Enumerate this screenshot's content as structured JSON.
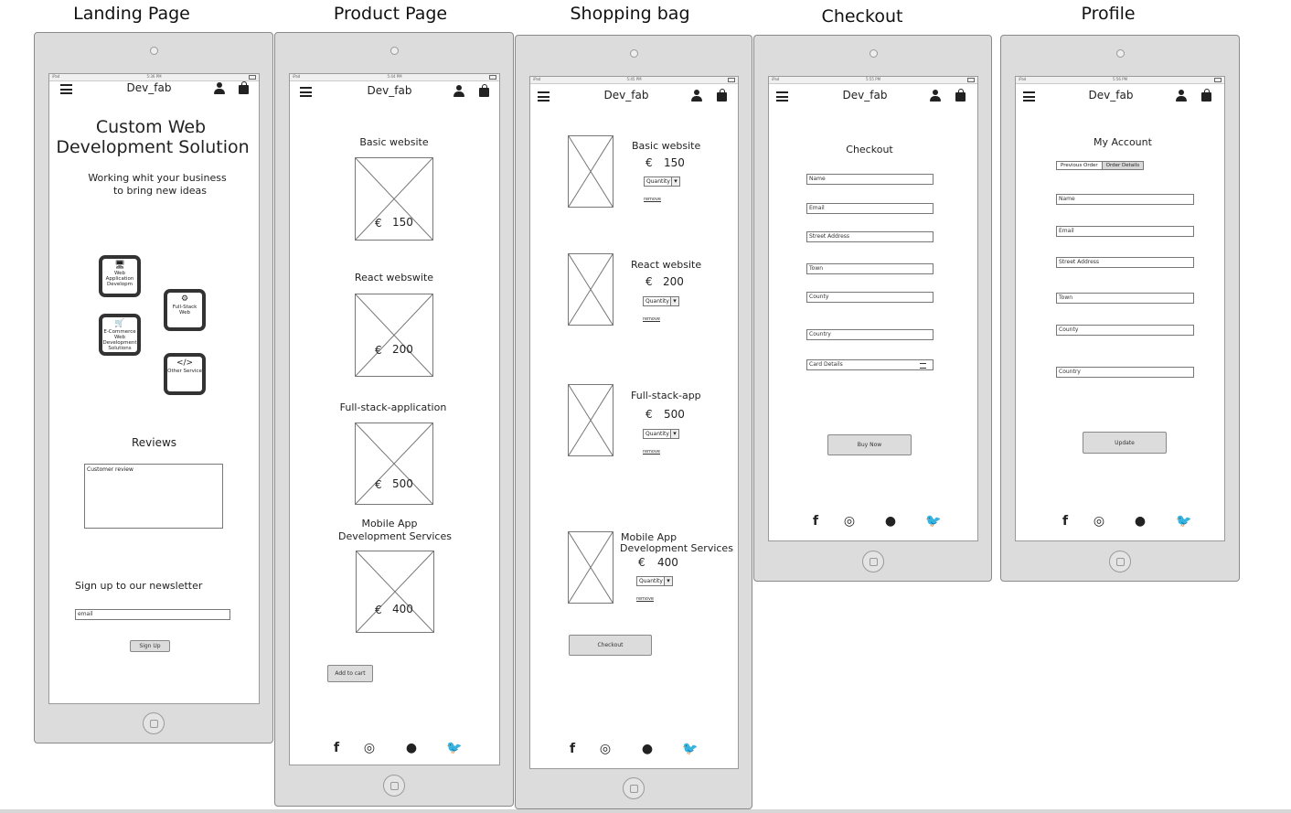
{
  "screens": {
    "landing": {
      "title": "Landing Page",
      "brand": "Dev_fab",
      "status_left": "iPad",
      "status_time": "5:36 PM",
      "hero_title_1": "Custom Web",
      "hero_title_2": "Development Solution",
      "tagline_1": "Working whit your business",
      "tagline_2": "to bring new ideas",
      "services": [
        {
          "label": "Web Application Developm",
          "icon": "monitor-icon"
        },
        {
          "label": "Full-Stack Web",
          "icon": "gears-icon"
        },
        {
          "label": "E-Commerce Web Development Solutions",
          "icon": "cart-icon"
        },
        {
          "label": "Other Service",
          "icon": "code-icon"
        }
      ],
      "reviews_heading": "Reviews",
      "review_placeholder": "Customer review",
      "newsletter_heading": "Sign up to our newsletter",
      "email_placeholder": "email",
      "signup_label": "Sign Up"
    },
    "product": {
      "title": "Product Page",
      "brand": "Dev_fab",
      "status_left": "iPad",
      "status_time": "5:44 PM",
      "products": [
        {
          "name": "Basic website",
          "currency": "€",
          "price": "150"
        },
        {
          "name": "React webswite",
          "currency": "€",
          "price": "200"
        },
        {
          "name": "Full-stack-application",
          "currency": "€",
          "price": "500"
        },
        {
          "name_1": "Mobile App",
          "name_2": "Development Services",
          "currency": "€",
          "price": "400"
        }
      ],
      "add_to_cart_label": "Add to cart"
    },
    "bag": {
      "title": "Shopping bag",
      "brand": "Dev_fab",
      "status_left": "iPad",
      "status_time": "5:45 PM",
      "items": [
        {
          "name": "Basic website",
          "currency": "€",
          "price": "150",
          "quantity": "Quantity",
          "remove": "remove"
        },
        {
          "name": "React website",
          "currency": "€",
          "price": "200",
          "quantity": "Quantity",
          "remove": "remove"
        },
        {
          "name": "Full-stack-app",
          "currency": "€",
          "price": "500",
          "quantity": "Quantity",
          "remove": "remove"
        },
        {
          "name_1": "Mobile App",
          "name_2": "Development Services",
          "currency": "€",
          "price": "400",
          "quantity": "Quantity",
          "remove": "remove"
        }
      ],
      "checkout_label": "Checkout"
    },
    "checkout": {
      "title": "Checkout",
      "brand": "Dev_fab",
      "status_left": "iPad",
      "status_time": "5:55 PM",
      "heading": "Checkout",
      "fields": [
        "Name",
        "Email",
        "Street Address",
        "Town",
        "County",
        "Country",
        "Card Details"
      ],
      "buy_label": "Buy Now"
    },
    "profile": {
      "title": "Profile",
      "brand": "Dev_fab",
      "status_left": "iPad",
      "status_time": "5:56 PM",
      "heading": "My Account",
      "tab_previous": "Previous Order",
      "tab_details": "Order Details",
      "fields": [
        "Name",
        "Email",
        "Street Address",
        "Town",
        "County",
        "Country"
      ],
      "update_label": "Update"
    }
  },
  "social_icons": [
    "facebook-icon",
    "instagram-icon",
    "github-icon",
    "twitter-icon"
  ]
}
